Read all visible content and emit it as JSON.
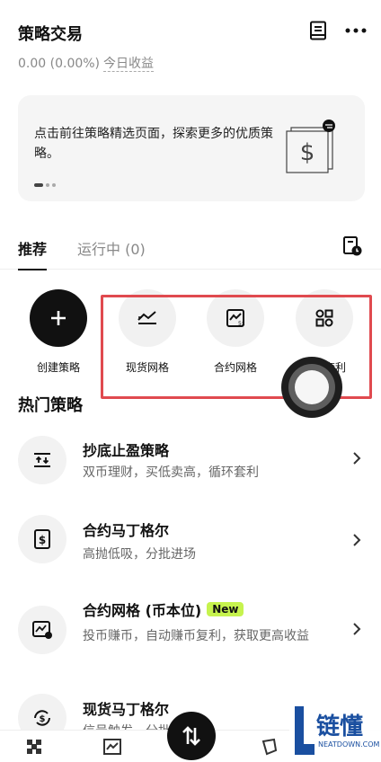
{
  "header": {
    "title": "策略交易"
  },
  "pnl": {
    "value": "0.00 (0.00%)",
    "label": "今日收益"
  },
  "banner": {
    "text": "点击前往策略精选页面，探索更多的优质策略。"
  },
  "tabs": [
    {
      "label": "推荐"
    },
    {
      "label": "运行中 (0)"
    }
  ],
  "quick_actions": [
    {
      "label": "创建策略",
      "icon": "plus-icon"
    },
    {
      "label": "现货网格",
      "icon": "spot-grid-icon"
    },
    {
      "label": "合约网格",
      "icon": "contract-grid-icon"
    },
    {
      "label": "期现套利",
      "icon": "arbitrage-icon"
    }
  ],
  "hot": {
    "title": "热门策略",
    "items": [
      {
        "title": "抄底止盈策略",
        "desc": "双币理财，买低卖高，循环套利"
      },
      {
        "title": "合约马丁格尔",
        "desc": "高抛低吸，分批进场"
      },
      {
        "title": "合约网格 (币本位)",
        "badge": "New",
        "desc": "投币赚币，自动赚币复利，获取更高收益"
      },
      {
        "title": "现货马丁格尔",
        "desc": "信号触发，分批进场"
      }
    ]
  },
  "watermark": {
    "text": "链懂",
    "sub": "NEATDOWN.COM"
  },
  "colors": {
    "highlight": "#e04a4f",
    "badge": "#c6f34e"
  }
}
